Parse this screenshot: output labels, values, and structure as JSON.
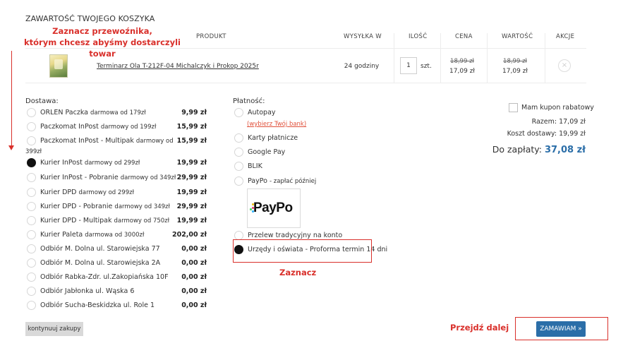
{
  "cart": {
    "title": "ZAWARTOŚĆ TWOJEGO KOSZYKA",
    "headers": [
      "PRODUKT",
      "WYSYŁKA W",
      "ILOŚĆ",
      "CENA",
      "WARTOŚĆ",
      "AKCJE"
    ],
    "item": {
      "name": "Terminarz Ola T-212F-04 Michalczyk i Prokop 2025r",
      "shipping": "24 godziny",
      "quantity": "1",
      "unit": "szt.",
      "price_old": "18,99 zł",
      "price_new": "17,09 zł",
      "value_old": "18,99 zł",
      "value_new": "17,09 zł",
      "remove_glyph": "×"
    }
  },
  "annotations": {
    "carrier_line1": "Zaznacz przewoźnika,",
    "carrier_line2": "którym chcesz abyśmy dostarczyli towar",
    "mark": "Zaznacz",
    "next": "Przejdź dalej"
  },
  "delivery": {
    "label": "Dostawa:",
    "options": [
      {
        "name": "ORLEN Paczka",
        "note": "darmowa od 179zł",
        "price": "9,99 zł",
        "checked": false
      },
      {
        "name": "Paczkomat InPost",
        "note": "darmowy od 199zł",
        "price": "15,99 zł",
        "checked": false
      },
      {
        "name": "Paczkomat InPost - Multipak",
        "note": "darmowy od",
        "note2": "399zł",
        "price": "15,99 zł",
        "checked": false
      },
      {
        "name": "Kurier InPost",
        "note": "darmowy od 299zł",
        "price": "19,99 zł",
        "checked": true
      },
      {
        "name": "Kurier InPost - Pobranie",
        "note": "darmowy od 349zł",
        "price": "29,99 zł",
        "checked": false
      },
      {
        "name": "Kurier DPD",
        "note": "darmowy od 299zł",
        "price": "19,99 zł",
        "checked": false
      },
      {
        "name": "Kurier DPD - Pobranie",
        "note": "darmowy od 349zł",
        "price": "29,99 zł",
        "checked": false
      },
      {
        "name": "Kurier DPD - Multipak",
        "note": "darmowy od 750zł",
        "price": "19,99 zł",
        "checked": false
      },
      {
        "name": "Kurier Paleta",
        "note": "darmowa od 3000zł",
        "price": "202,00 zł",
        "checked": false
      },
      {
        "name": "Odbiór M. Dolna ul. Starowiejska 77",
        "note": "",
        "price": "0,00 zł",
        "checked": false
      },
      {
        "name": "Odbiór M. Dolna ul. Starowiejska 2A",
        "note": "",
        "price": "0,00 zł",
        "checked": false
      },
      {
        "name": "Odbiór Rabka-Zdr. ul.Zakopiańska 10F",
        "note": "",
        "price": "0,00 zł",
        "checked": false
      },
      {
        "name": "Odbiór Jabłonka ul. Wąska 6",
        "note": "",
        "price": "0,00 zł",
        "checked": false
      },
      {
        "name": "Odbiór Sucha-Beskidzka ul. Role 1",
        "note": "",
        "price": "0,00 zł",
        "checked": false
      }
    ]
  },
  "payment": {
    "label": "Płatność:",
    "options": [
      {
        "name": "Autopay",
        "checked": false
      },
      {
        "name": "Karty płatnicze",
        "checked": false
      },
      {
        "name": "Google Pay",
        "checked": false
      },
      {
        "name": "BLIK",
        "checked": false
      },
      {
        "name": "PayPo",
        "note": "- zapłać później",
        "checked": false
      },
      {
        "name": "Przelew tradycyjny na konto",
        "checked": false
      },
      {
        "name": "Urzędy i oświata - Proforma termin 14 dni",
        "checked": true
      }
    ],
    "bank_link": "(wybierz Twój bank)",
    "paypo_logo": "PayPo",
    "paypo_dot_colors": [
      "#f0c419",
      "#e94e77",
      "#38b6ff",
      "#4cd964"
    ]
  },
  "summary": {
    "coupon_label": "Mam kupon rabatowy",
    "subtotal": "Razem: 17,09 zł",
    "shipping_cost": "Koszt dostawy: 19,99 zł",
    "to_pay_label": "Do zapłaty:",
    "to_pay_value": "37,08 zł"
  },
  "buttons": {
    "continue": "kontynuuj zakupy",
    "order": "ZAMAWIAM »"
  },
  "colors": {
    "accent": "#2b6ea8",
    "annotation": "#d9302b",
    "bank_link": "#e0503a"
  }
}
